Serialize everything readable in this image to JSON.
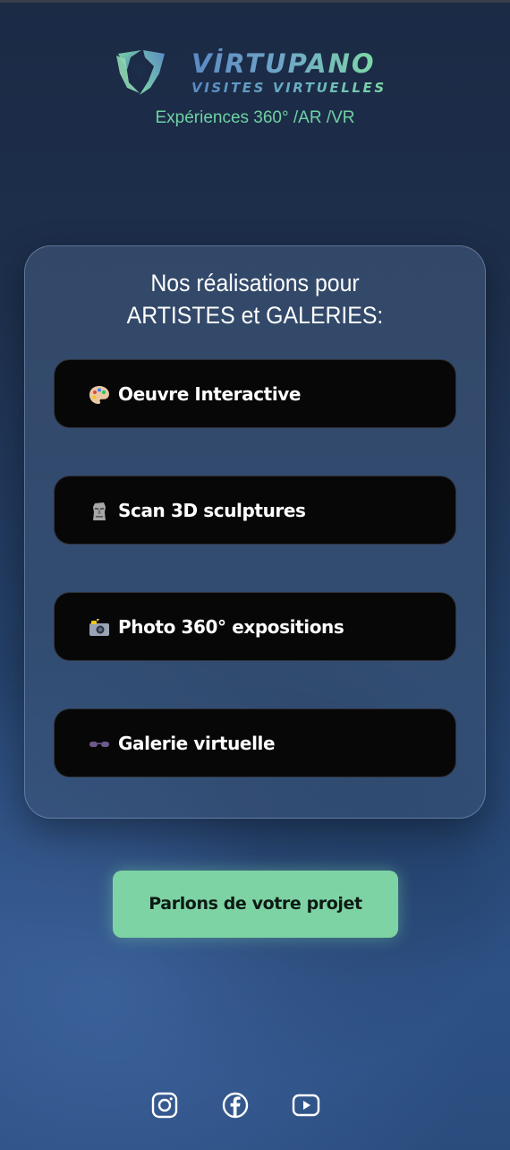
{
  "brand": {
    "title": "VİRTUPANO",
    "subtitle": "VISITES VIRTUELLES",
    "tagline": "Expériences 360° /AR /VR"
  },
  "card": {
    "title_line1": "Nos réalisations pour",
    "title_line2": "ARTISTES et GALERIES:",
    "items": [
      {
        "icon": "palette-icon",
        "label": "Oeuvre Interactive"
      },
      {
        "icon": "moai-statue-icon",
        "label": "Scan 3D sculptures"
      },
      {
        "icon": "camera-flash-icon",
        "label": "Photo 360° expositions"
      },
      {
        "icon": "vr-glasses-icon",
        "label": "Galerie virtuelle"
      }
    ]
  },
  "cta": {
    "label": "Parlons de votre projet"
  },
  "social": [
    {
      "icon": "instagram-icon"
    },
    {
      "icon": "facebook-icon"
    },
    {
      "icon": "youtube-icon"
    }
  ],
  "colors": {
    "accent": "#7dd3a3",
    "background_top": "#1b2a45",
    "background_bottom": "#2d5185",
    "button_bg": "#070708"
  }
}
